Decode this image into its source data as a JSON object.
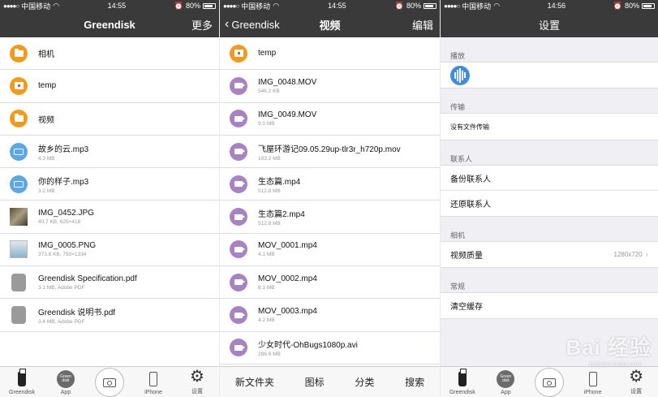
{
  "status": {
    "carrier": "中国移动",
    "time": "14:55",
    "time3": "14:56",
    "battery": "80%"
  },
  "panel1": {
    "title": "Greendisk",
    "right": "更多",
    "items": [
      {
        "name": "相机",
        "meta": "",
        "type": "folder"
      },
      {
        "name": "temp",
        "meta": "",
        "type": "locked-folder"
      },
      {
        "name": "视频",
        "meta": "",
        "type": "folder"
      },
      {
        "name": "故乡的云.mp3",
        "meta": "4.3 MB",
        "type": "audio"
      },
      {
        "name": "你的样子.mp3",
        "meta": "3.2 MB",
        "type": "audio"
      },
      {
        "name": "IMG_0452.JPG",
        "meta": "40.7 KB, 625×418",
        "type": "photo"
      },
      {
        "name": "IMG_0005.PNG",
        "meta": "373.8 KB, 750×1334",
        "type": "screenshot"
      },
      {
        "name": "Greendisk Specification.pdf",
        "meta": "3.1 MB, Adobe PDF",
        "type": "pdf"
      },
      {
        "name": "Greendisk 说明书.pdf",
        "meta": "3.4 MB, Adobe PDF",
        "type": "pdf"
      }
    ]
  },
  "panel2": {
    "back": "Greendisk",
    "title": "视频",
    "right": "编辑",
    "items": [
      {
        "name": "temp",
        "meta": "",
        "type": "locked-folder"
      },
      {
        "name": "IMG_0048.MOV",
        "meta": "546.2 KB",
        "type": "video"
      },
      {
        "name": "IMG_0049.MOV",
        "meta": "9.0 MB",
        "type": "video"
      },
      {
        "name": "飞屋环游记09.05.29up-tlr3r_h720p.mov",
        "meta": "103.2 MB",
        "type": "video"
      },
      {
        "name": "生态篇.mp4",
        "meta": "512.8 MB",
        "type": "video"
      },
      {
        "name": "生态篇2.mp4",
        "meta": "512.8 MB",
        "type": "video"
      },
      {
        "name": "MOV_0001.mp4",
        "meta": "4.1 MB",
        "type": "video"
      },
      {
        "name": "MOV_0002.mp4",
        "meta": "6.1 MB",
        "type": "video"
      },
      {
        "name": "MOV_0003.mp4",
        "meta": "4.2 MB",
        "type": "video"
      },
      {
        "name": "少女时代-OhBugs1080p.avi",
        "meta": "286.6 MB",
        "type": "video"
      }
    ],
    "toolbar": [
      "新文件夹",
      "图标",
      "分类",
      "搜索"
    ]
  },
  "panel3": {
    "title": "设置",
    "groups": {
      "play": "播放",
      "transfer": "传输",
      "transfer_empty": "没有文件传输",
      "contacts": "联系人",
      "backup": "备份联系人",
      "restore": "还原联系人",
      "camera": "相机",
      "video_quality": "视频质量",
      "video_quality_value": "1280x720",
      "general": "常规",
      "clear_cache": "清空缓存"
    }
  },
  "tabs": {
    "greendisk": "Greendisk",
    "app": "App",
    "iphone": "iPhone",
    "settings": "设置",
    "app_badge": "Green disk"
  },
  "watermark": {
    "brand": "Bai 经验",
    "sub": "jingyan.baidu.com"
  }
}
